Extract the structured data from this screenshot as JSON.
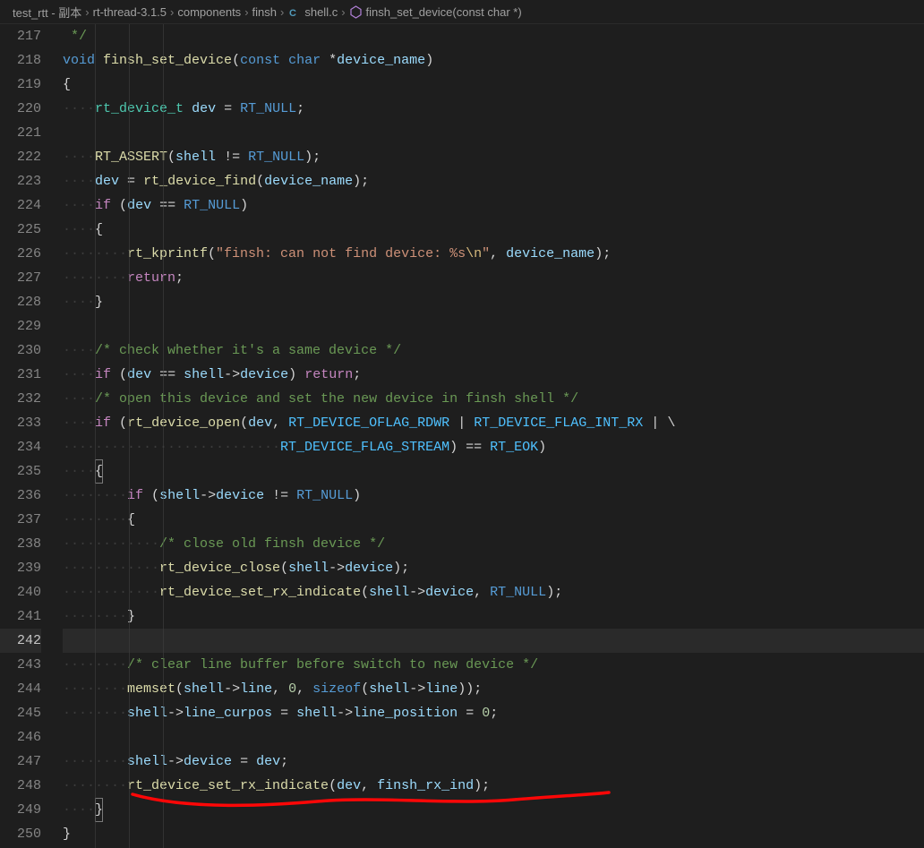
{
  "breadcrumbs": {
    "items": [
      {
        "label": "test_rtt - 副本",
        "kind": "folder"
      },
      {
        "label": "rt-thread-3.1.5",
        "kind": "folder"
      },
      {
        "label": "components",
        "kind": "folder"
      },
      {
        "label": "finsh",
        "kind": "folder"
      },
      {
        "label": "shell.c",
        "kind": "c-file"
      },
      {
        "label": "finsh_set_device(const char *)",
        "kind": "symbol"
      }
    ],
    "sep": "›"
  },
  "gutter": {
    "start": 217,
    "end": 250,
    "highlight": 242
  },
  "colors": {
    "bg": "#1e1e1e",
    "keyword": "#569cd6",
    "function": "#dcdcaa",
    "identifier": "#9cdcfe",
    "type": "#4ec9b0",
    "comment": "#6a9955",
    "string": "#ce9178",
    "constant": "#4fc1ff",
    "number": "#b5cea8",
    "control": "#c586c0",
    "whitespace": "#3b3b3b",
    "escape": "#d7ba7d",
    "underline": "#ff0707"
  },
  "code": {
    "l217": {
      "ws": " ",
      "c1": "*/"
    },
    "l218": {
      "k1": "void",
      "sp": " ",
      "fn": "finsh_set_device",
      "p1": "(",
      "k2": "const",
      "sp2": " ",
      "k3": "char",
      "sp3": " ",
      "op": "*",
      "id": "device_name",
      "p2": ")"
    },
    "l219": {
      "t": "{"
    },
    "l220": {
      "ws": "····",
      "ty": "rt_device_t",
      "sp": " ",
      "id": "dev",
      "sp2": " ",
      "op": "=",
      "sp3": " ",
      "nu": "RT_NULL",
      "sc": ";"
    },
    "l221": {
      "t": ""
    },
    "l222": {
      "ws": "····",
      "fn": "RT_ASSERT",
      "p1": "(",
      "id": "shell",
      "sp": " ",
      "op": "!=",
      "sp2": " ",
      "nu": "RT_NULL",
      "p2": ")",
      "sc": ";"
    },
    "l223": {
      "ws": "····",
      "id": "dev",
      "sp": " ",
      "op": "=",
      "sp2": " ",
      "fn": "rt_device_find",
      "p1": "(",
      "id2": "device_name",
      "p2": ")",
      "sc": ";"
    },
    "l224": {
      "ws": "····",
      "k": "if",
      "sp": " ",
      "p1": "(",
      "id": "dev",
      "sp2": " ",
      "op": "==",
      "sp3": " ",
      "nu": "RT_NULL",
      "p2": ")"
    },
    "l225": {
      "ws": "····",
      "t": "{"
    },
    "l226": {
      "ws": "········",
      "fn": "rt_kprintf",
      "p1": "(",
      "s": "\"finsh: can not find device: %s",
      "esc": "\\n",
      "s2": "\"",
      "cm": ",",
      "sp": " ",
      "id": "device_name",
      "p2": ")",
      "sc": ";"
    },
    "l227": {
      "ws": "········",
      "k": "return",
      "sc": ";"
    },
    "l228": {
      "ws": "····",
      "t": "}"
    },
    "l229": {
      "t": ""
    },
    "l230": {
      "ws": "····",
      "c": "/* check whether it's a same device */"
    },
    "l231": {
      "ws": "····",
      "k": "if",
      "sp": " ",
      "p1": "(",
      "id": "dev",
      "sp2": " ",
      "op": "==",
      "sp3": " ",
      "id2": "shell",
      "ar": "->",
      "id3": "device",
      "p2": ")",
      "sp4": " ",
      "rt": "return",
      "sc": ";"
    },
    "l232": {
      "ws": "····",
      "c": "/* open this device and set the new device in finsh shell */"
    },
    "l233": {
      "ws": "····",
      "k": "if",
      "sp": " ",
      "p1": "(",
      "fn": "rt_device_open",
      "p2": "(",
      "id": "dev",
      "cm": ",",
      "sp2": " ",
      "c1": "RT_DEVICE_OFLAG_RDWR",
      "sp3": " ",
      "op": "|",
      "sp4": " ",
      "c2": "RT_DEVICE_FLAG_INT_RX",
      "sp5": " ",
      "op2": "|",
      "sp6": " ",
      "bs": "\\"
    },
    "l234": {
      "ws": "···························",
      "c1": "RT_DEVICE_FLAG_STREAM",
      "p1": ")",
      "sp": " ",
      "op": "==",
      "sp2": " ",
      "c2": "RT_EOK",
      "p2": ")"
    },
    "l235": {
      "ws": "····",
      "t": "{"
    },
    "l236": {
      "ws": "········",
      "k": "if",
      "sp": " ",
      "p1": "(",
      "id": "shell",
      "ar": "->",
      "id2": "device",
      "sp2": " ",
      "op": "!=",
      "sp3": " ",
      "nu": "RT_NULL",
      "p2": ")"
    },
    "l237": {
      "ws": "········",
      "t": "{"
    },
    "l238": {
      "ws": "············",
      "c": "/* close old finsh device */"
    },
    "l239": {
      "ws": "············",
      "fn": "rt_device_close",
      "p1": "(",
      "id": "shell",
      "ar": "->",
      "id2": "device",
      "p2": ")",
      "sc": ";"
    },
    "l240": {
      "ws": "············",
      "fn": "rt_device_set_rx_indicate",
      "p1": "(",
      "id": "shell",
      "ar": "->",
      "id2": "device",
      "cm": ",",
      "sp": " ",
      "nu": "RT_NULL",
      "p2": ")",
      "sc": ";"
    },
    "l241": {
      "ws": "········",
      "t": "}"
    },
    "l242": {
      "t": ""
    },
    "l243": {
      "ws": "········",
      "c": "/* clear line buffer before switch to new device */"
    },
    "l244": {
      "ws": "········",
      "fn": "memset",
      "p1": "(",
      "id": "shell",
      "ar": "->",
      "id2": "line",
      "cm": ",",
      "sp": " ",
      "n": "0",
      "cm2": ",",
      "sp2": " ",
      "k": "sizeof",
      "p2": "(",
      "id3": "shell",
      "ar2": "->",
      "id4": "line",
      "p3": ")",
      "p4": ")",
      "sc": ";"
    },
    "l245": {
      "ws": "········",
      "id": "shell",
      "ar": "->",
      "id2": "line_curpos",
      "sp": " ",
      "op": "=",
      "sp2": " ",
      "id3": "shell",
      "ar2": "->",
      "id4": "line_position",
      "sp3": " ",
      "op2": "=",
      "sp4": " ",
      "n": "0",
      "sc": ";"
    },
    "l246": {
      "t": ""
    },
    "l247": {
      "ws": "········",
      "id": "shell",
      "ar": "->",
      "id2": "device",
      "sp": " ",
      "op": "=",
      "sp2": " ",
      "id3": "dev",
      "sc": ";"
    },
    "l248": {
      "ws": "········",
      "fn": "rt_device_set_rx_indicate",
      "p1": "(",
      "id": "dev",
      "cm": ",",
      "sp": " ",
      "id2": "finsh_rx_ind",
      "p2": ")",
      "sc": ";"
    },
    "l249": {
      "ws": "····",
      "t": "}"
    },
    "l250": {
      "t": "}"
    }
  }
}
